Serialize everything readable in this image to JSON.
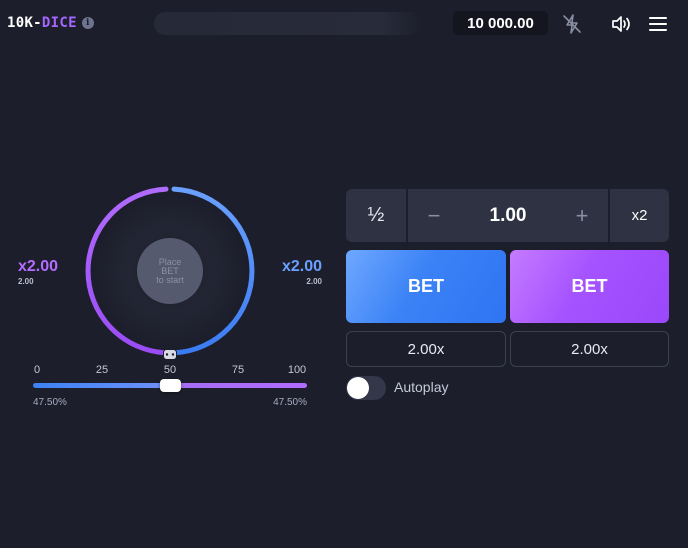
{
  "header": {
    "logo_part1": "10K-",
    "logo_part2": "DICE",
    "info_glyph": "i",
    "balance": "10 000.00",
    "icons": [
      "no-lightning-icon",
      "volume-icon",
      "menu-icon"
    ]
  },
  "dice": {
    "center_line1": "Place",
    "center_line2": "BET",
    "center_line3": "to start",
    "left_multiplier": "x2.00",
    "left_multiplier_small": "2.00",
    "right_multiplier": "x2.00",
    "right_multiplier_small": "2.00",
    "ticks": [
      "0",
      "25",
      "50",
      "75",
      "100"
    ],
    "slider_value": 50,
    "left_percent": "47.50%",
    "right_percent": "47.50%"
  },
  "bet_panel": {
    "half_label": "½",
    "minus_label": "−",
    "amount": "1.00",
    "plus_label": "+",
    "double_label": "x2",
    "bet_left_label": "BET",
    "bet_right_label": "BET",
    "payout_left": "2.00x",
    "payout_right": "2.00x",
    "autoplay_label": "Autoplay",
    "autoplay_on": false
  },
  "colors": {
    "background": "#1c1e2b",
    "blue_accent": "#3b82f6",
    "purple_accent": "#a552ff"
  }
}
